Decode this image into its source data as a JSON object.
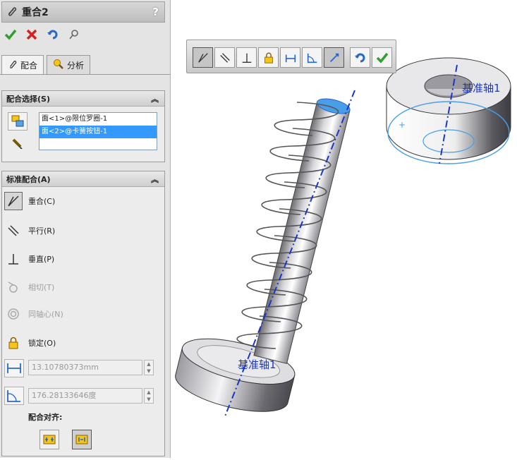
{
  "panel": {
    "title": "重合2",
    "help": "?",
    "tabs": [
      {
        "label": "配合",
        "icon": "paperclip-icon"
      },
      {
        "label": "分析",
        "icon": "analysis-icon"
      }
    ],
    "selections_group": {
      "header": "配合选择(S)",
      "items": [
        "面<1>@限位罗圈-1",
        "面<2>@卡簧按钮-1"
      ]
    },
    "standard_group": {
      "header": "标准配合(A)",
      "mates": [
        {
          "label": "重合(C)",
          "icon": "coincident-icon",
          "enabled": true
        },
        {
          "label": "平行(R)",
          "icon": "parallel-icon",
          "enabled": true
        },
        {
          "label": "垂直(P)",
          "icon": "perpendicular-icon",
          "enabled": true
        },
        {
          "label": "相切(T)",
          "icon": "tangent-icon",
          "enabled": false
        },
        {
          "label": "同轴心(N)",
          "icon": "concentric-icon",
          "enabled": false
        },
        {
          "label": "锁定(O)",
          "icon": "lock-icon",
          "enabled": true
        }
      ],
      "distance_value": "13.10780373mm",
      "angle_value": "176.28133646度",
      "align_label": "配合对齐:"
    }
  },
  "viewport": {
    "axis_label_1": "基准轴1",
    "axis_label_2": "基准轴1"
  },
  "colors": {
    "accent_blue": "#3399ff",
    "axis_blue": "#1a36c8",
    "ok_green": "#2ea02e",
    "cancel_red": "#d42020"
  }
}
